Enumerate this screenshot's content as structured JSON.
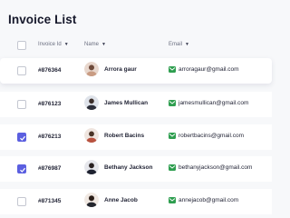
{
  "page": {
    "title": "Invoice List"
  },
  "columns": [
    {
      "label": "Invoice Id"
    },
    {
      "label": "Name"
    },
    {
      "label": "Email"
    }
  ],
  "rows": [
    {
      "invoice": "#876364",
      "name": "Arrora gaur",
      "email": "arroragaur@gmail.com",
      "checked": false
    },
    {
      "invoice": "#876123",
      "name": "James Mullican",
      "email": "jamesmullican@gmail.com",
      "checked": false
    },
    {
      "invoice": "#876213",
      "name": "Robert Bacins",
      "email": "robertbacins@gmail.com",
      "checked": true
    },
    {
      "invoice": "#876987",
      "name": "Bethany Jackson",
      "email": "bethanyjackson@gmail.com",
      "checked": true
    },
    {
      "invoice": "#871345",
      "name": "Anne Jacob",
      "email": "annejacob@gmail.com",
      "checked": false
    }
  ],
  "colors": {
    "accent": "#5b5fe0",
    "mail": "#2e9e4f"
  }
}
